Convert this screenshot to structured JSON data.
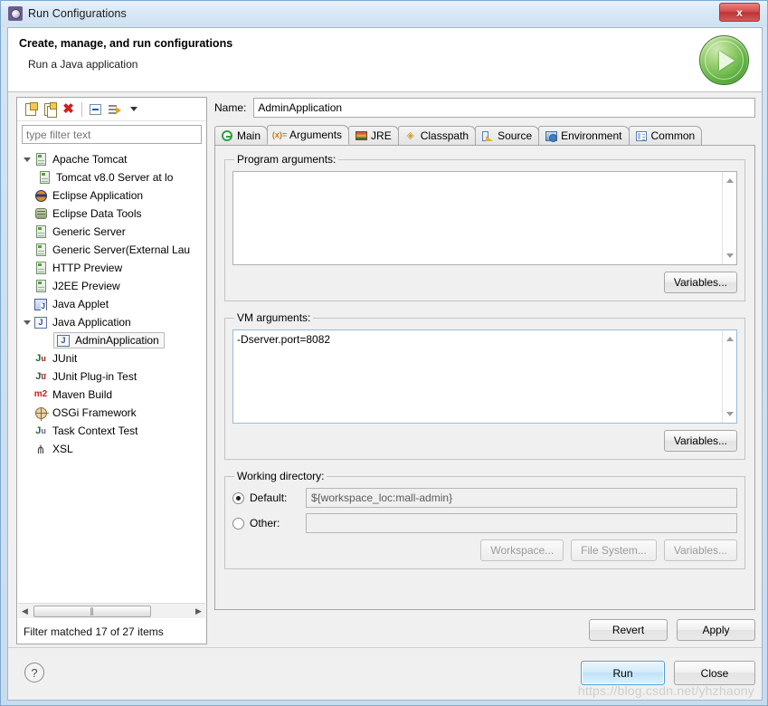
{
  "window": {
    "title": "Run Configurations",
    "title_icon": "gear-icon",
    "close_label": "x"
  },
  "header": {
    "title": "Create, manage, and run configurations",
    "subtitle": "Run a Java application",
    "badge_icon": "run-play-icon"
  },
  "left_panel": {
    "toolbar": [
      {
        "name": "new-configuration-icon",
        "label": ""
      },
      {
        "name": "duplicate-configuration-icon",
        "label": ""
      },
      {
        "name": "delete-configuration-icon",
        "label": "✖"
      },
      {
        "name": "collapse-all-icon",
        "label": ""
      },
      {
        "name": "filter-configurations-icon",
        "label": ""
      },
      {
        "name": "view-menu-chevron-icon",
        "label": ""
      }
    ],
    "filter": {
      "value": "",
      "placeholder": "type filter text"
    },
    "tree": [
      {
        "label": "Apache Tomcat",
        "icon": "server-icon",
        "indent": 0,
        "expanded": true,
        "selected": false
      },
      {
        "label": "Tomcat v8.0 Server at lo",
        "icon": "server-icon",
        "indent": 1,
        "expanded": null,
        "selected": false
      },
      {
        "label": "Eclipse Application",
        "icon": "eclipse-icon",
        "indent": 0,
        "expanded": null,
        "selected": false
      },
      {
        "label": "Eclipse Data Tools",
        "icon": "database-icon",
        "indent": 0,
        "expanded": null,
        "selected": false
      },
      {
        "label": "Generic Server",
        "icon": "server-icon",
        "indent": 0,
        "expanded": null,
        "selected": false
      },
      {
        "label": "Generic Server(External Lau",
        "icon": "server-icon",
        "indent": 0,
        "expanded": null,
        "selected": false
      },
      {
        "label": "HTTP Preview",
        "icon": "server-icon",
        "indent": 0,
        "expanded": null,
        "selected": false
      },
      {
        "label": "J2EE Preview",
        "icon": "server-icon",
        "indent": 0,
        "expanded": null,
        "selected": false
      },
      {
        "label": "Java Applet",
        "icon": "java-applet-icon",
        "indent": 0,
        "expanded": null,
        "selected": false
      },
      {
        "label": "Java Application",
        "icon": "java-application-icon",
        "indent": 0,
        "expanded": true,
        "selected": false
      },
      {
        "label": "AdminApplication",
        "icon": "java-application-icon",
        "indent": 2,
        "expanded": null,
        "selected": true
      },
      {
        "label": "JUnit",
        "icon": "junit-icon",
        "indent": 0,
        "expanded": null,
        "selected": false
      },
      {
        "label": "JUnit Plug-in Test",
        "icon": "junit-plugin-icon",
        "indent": 0,
        "expanded": null,
        "selected": false
      },
      {
        "label": "Maven Build",
        "icon": "maven-icon",
        "indent": 0,
        "expanded": null,
        "selected": false
      },
      {
        "label": "OSGi Framework",
        "icon": "osgi-icon",
        "indent": 0,
        "expanded": null,
        "selected": false
      },
      {
        "label": "Task Context Test",
        "icon": "task-context-icon",
        "indent": 0,
        "expanded": null,
        "selected": false
      },
      {
        "label": "XSL",
        "icon": "xsl-icon",
        "indent": 0,
        "expanded": null,
        "selected": false
      }
    ],
    "status": "Filter matched 17 of 27 items",
    "hscroll_grip": "‖‖"
  },
  "right_panel": {
    "name_label": "Name:",
    "name_value": "AdminApplication",
    "tabs": [
      {
        "label": "Main",
        "icon": "main-icon",
        "active": false
      },
      {
        "label": "Arguments",
        "icon": "arguments-icon",
        "active": true
      },
      {
        "label": "JRE",
        "icon": "jre-icon",
        "active": false
      },
      {
        "label": "Classpath",
        "icon": "classpath-icon",
        "active": false
      },
      {
        "label": "Source",
        "icon": "source-icon",
        "active": false
      },
      {
        "label": "Environment",
        "icon": "environment-icon",
        "active": false
      },
      {
        "label": "Common",
        "icon": "common-icon",
        "active": false
      }
    ],
    "program_arguments": {
      "legend": "Program arguments:",
      "value": "",
      "variables_label": "Variables..."
    },
    "vm_arguments": {
      "legend": "VM arguments:",
      "value": "-Dserver.port=8082",
      "variables_label": "Variables..."
    },
    "working_directory": {
      "legend": "Working directory:",
      "default_label": "Default:",
      "default_value": "${workspace_loc:mall-admin}",
      "default_selected": true,
      "other_label": "Other:",
      "other_value": "",
      "other_selected": false,
      "workspace_label": "Workspace...",
      "file_system_label": "File System...",
      "variables_label": "Variables..."
    },
    "revert_label": "Revert",
    "apply_label": "Apply"
  },
  "footer": {
    "help_label": "?",
    "run_label": "Run",
    "close_label": "Close"
  },
  "watermark": "https://blog.csdn.net/yhzhaony",
  "colors": {
    "accent_blue": "#4f9ed4",
    "close_red": "#b93434",
    "run_green": "#64b445",
    "dialog_bg": "#f0f0f0"
  }
}
